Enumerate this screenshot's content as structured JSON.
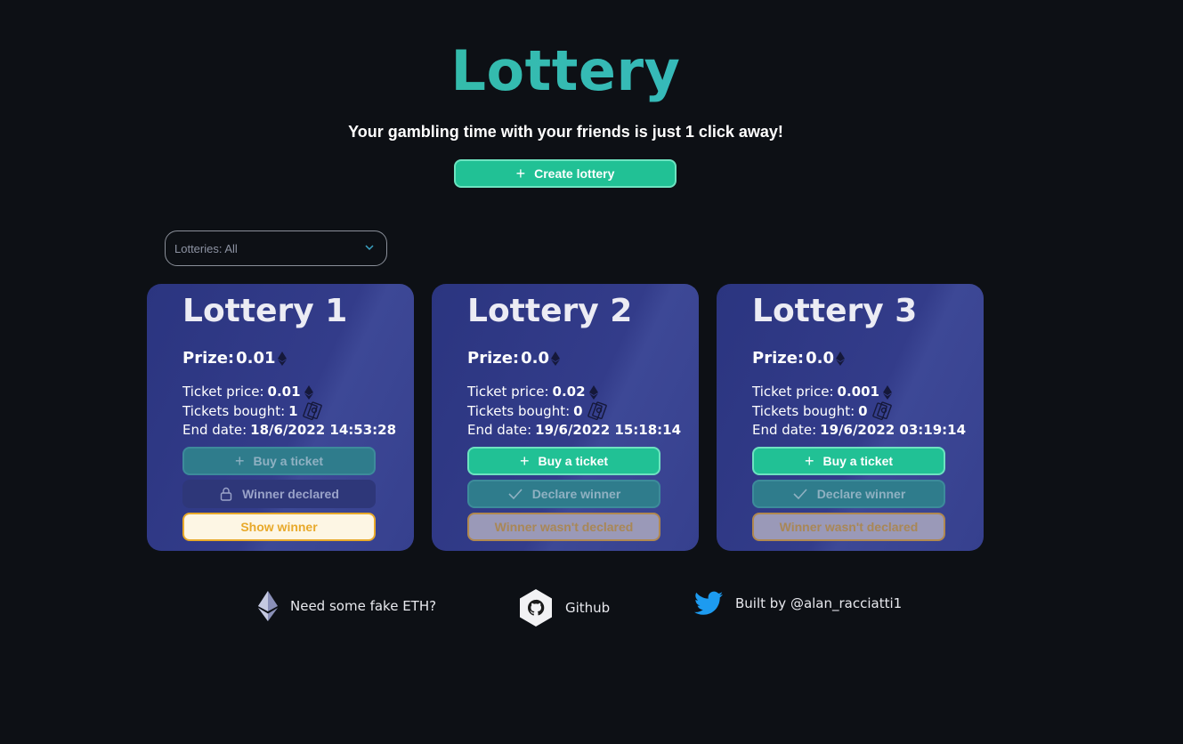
{
  "header": {
    "title": "Lottery",
    "subtitle": "Your gambling time with your friends is just 1 click away!",
    "create_label": "Create lottery"
  },
  "filter": {
    "label": "Lotteries: All"
  },
  "lotteries": [
    {
      "name": "Lottery 1",
      "prize_label": "Prize: ",
      "prize": "0.01",
      "ticket_price_label": "Ticket price: ",
      "ticket_price": "0.01",
      "tickets_bought_label": "Tickets bought: ",
      "tickets_bought": "1",
      "end_date_label": "End date: ",
      "end_date": "18/6/2022 14:53:28",
      "buy_label": "Buy a ticket",
      "declare_label": "Winner declared",
      "winner_label": "Show winner"
    },
    {
      "name": "Lottery 2",
      "prize_label": "Prize: ",
      "prize": "0.0",
      "ticket_price_label": "Ticket price: ",
      "ticket_price": "0.02",
      "tickets_bought_label": "Tickets bought: ",
      "tickets_bought": "0",
      "end_date_label": "End date: ",
      "end_date": "19/6/2022 15:18:14",
      "buy_label": "Buy a ticket",
      "declare_label": "Declare winner",
      "winner_label": "Winner wasn't declared"
    },
    {
      "name": "Lottery 3",
      "prize_label": "Prize: ",
      "prize": "0.0",
      "ticket_price_label": "Ticket price: ",
      "ticket_price": "0.001",
      "tickets_bought_label": "Tickets bought: ",
      "tickets_bought": "0",
      "end_date_label": "End date: ",
      "end_date": "19/6/2022 03:19:14",
      "buy_label": "Buy a ticket",
      "declare_label": "Declare winner",
      "winner_label": "Winner wasn't declared"
    }
  ],
  "footer": {
    "faucet_label": "Need some fake ETH?",
    "github_label": "Github",
    "twitter_label": "Built by @alan_racciatti1"
  },
  "icons": {
    "eth": "ethereum-icon",
    "bills": "money-bills-icon",
    "plus": "plus-icon",
    "lock": "lock-icon",
    "check": "check-icon",
    "github": "github-icon",
    "twitter": "twitter-icon",
    "chevron": "chevron-down-icon"
  },
  "colors": {
    "background": "#0d1015",
    "accent": "#21c195",
    "card": "#333c8a",
    "warning": "#e8a92a",
    "twitter": "#1d9bf0"
  }
}
